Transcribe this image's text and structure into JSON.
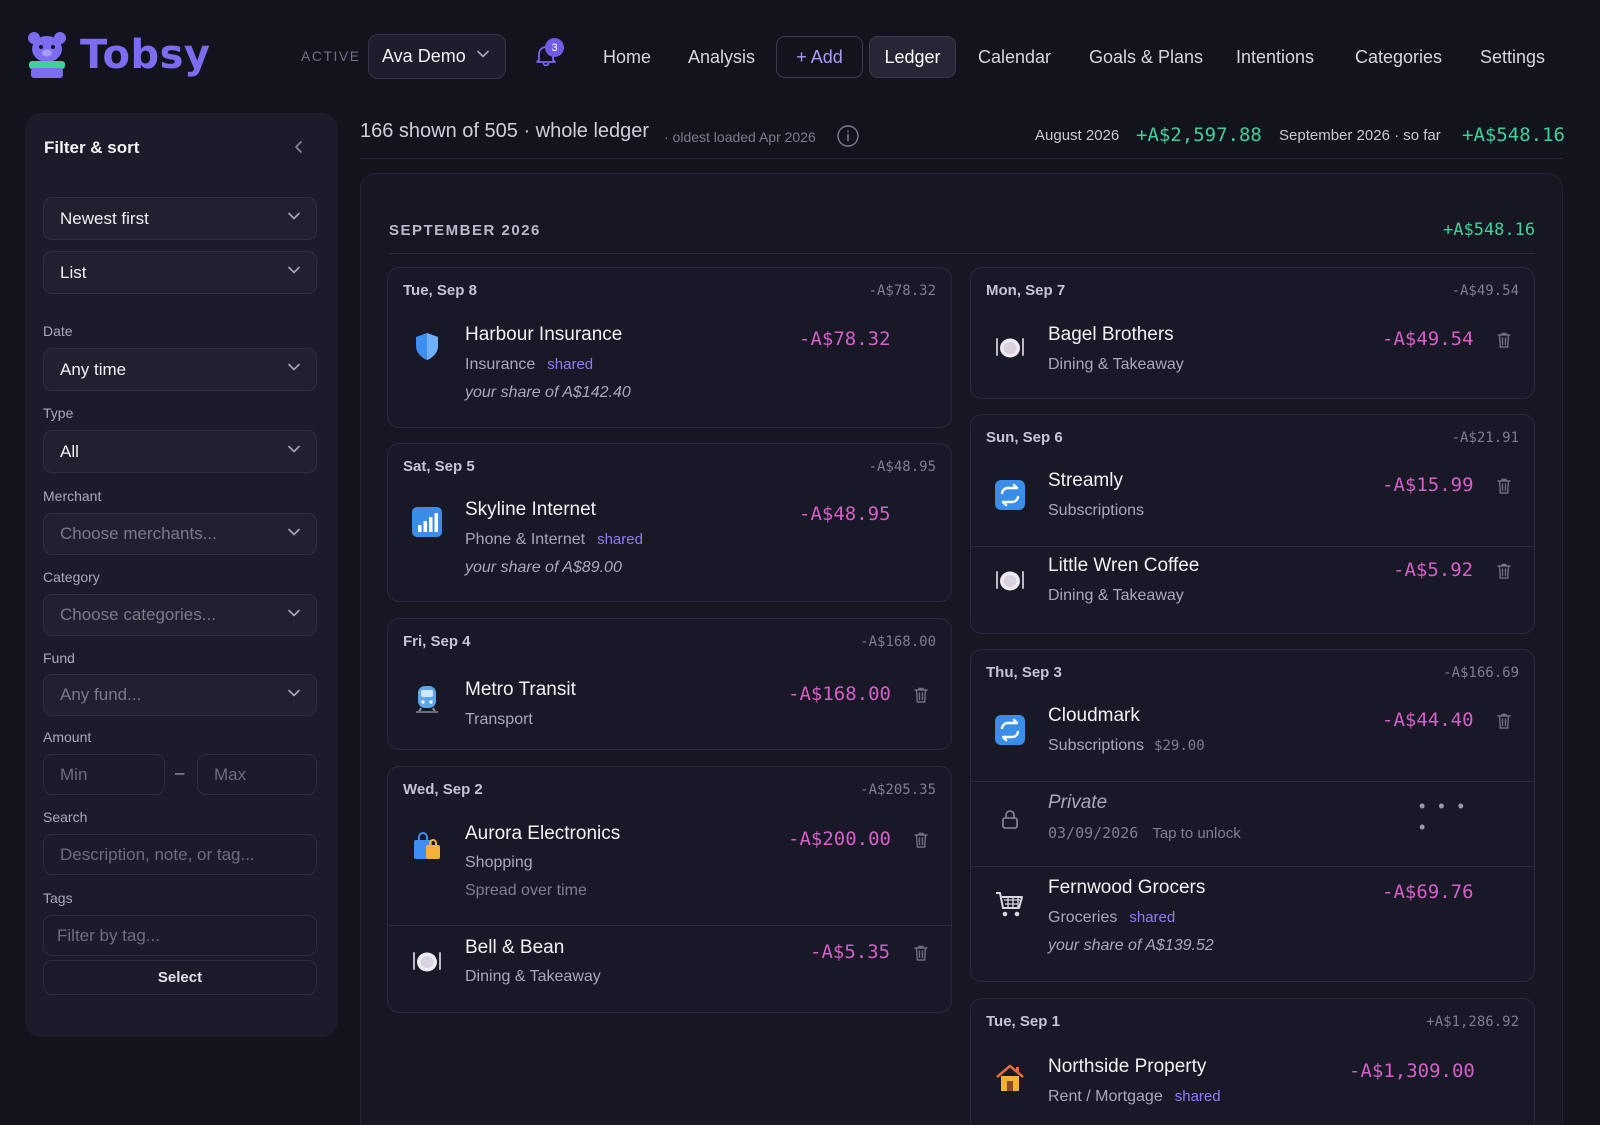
{
  "app": {
    "name": "Tobsy"
  },
  "header": {
    "active_label": "ACTIVE",
    "profile": "Ava Demo",
    "notifications": "3",
    "nav": {
      "home": "Home",
      "analysis": "Analysis",
      "add": "+ Add",
      "ledger": "Ledger",
      "calendar": "Calendar",
      "goals": "Goals & Plans",
      "intentions": "Intentions",
      "categories": "Categories",
      "settings": "Settings"
    }
  },
  "sidebar": {
    "title": "Filter & sort",
    "sort": "Newest first",
    "view": "List",
    "date_label": "Date",
    "date": "Any time",
    "type_label": "Type",
    "type": "All",
    "merchant_label": "Merchant",
    "merchant_placeholder": "Choose merchants...",
    "category_label": "Category",
    "category_placeholder": "Choose categories...",
    "fund_label": "Fund",
    "fund_placeholder": "Any fund...",
    "amount_label": "Amount",
    "min_placeholder": "Min",
    "amount_sep": "–",
    "max_placeholder": "Max",
    "search_label": "Search",
    "search_placeholder": "Description, note, or tag...",
    "tags_label": "Tags",
    "tags_placeholder": "Filter by tag...",
    "select_button": "Select"
  },
  "summary": {
    "shown": "166 shown of 505 · whole ledger",
    "oldest": "· oldest loaded Apr 2026",
    "august_label": "August 2026",
    "august_amount": "+A$2,597.88",
    "september_label": "September 2026 · so far",
    "september_amount": "+A$548.16"
  },
  "section": {
    "title": "SEPTEMBER 2026",
    "total": "+A$548.16"
  },
  "left_days": [
    {
      "day": "Tue, Sep 8",
      "total": "-A$78.32",
      "tx": [
        {
          "name": "Harbour Insurance",
          "category": "Insurance",
          "shared": "shared",
          "share": "your share of A$142.40",
          "amount": "-A$78.32",
          "icon": "shield-icon"
        }
      ]
    },
    {
      "day": "Sat, Sep 5",
      "total": "-A$48.95",
      "tx": [
        {
          "name": "Skyline Internet",
          "category": "Phone & Internet",
          "shared": "shared",
          "share": "your share of A$89.00",
          "amount": "-A$48.95",
          "icon": "signal-icon"
        }
      ]
    },
    {
      "day": "Fri, Sep 4",
      "total": "-A$168.00",
      "tx": [
        {
          "name": "Metro Transit",
          "category": "Transport",
          "amount": "-A$168.00",
          "icon": "metro-icon"
        }
      ]
    },
    {
      "day": "Wed, Sep 2",
      "total": "-A$205.35",
      "tx": [
        {
          "name": "Aurora Electronics",
          "category": "Shopping",
          "note": "Spread over time",
          "amount": "-A$200.00",
          "icon": "shopping-bags-icon"
        },
        {
          "name": "Bell & Bean",
          "category": "Dining & Takeaway",
          "amount": "-A$5.35",
          "icon": "plate-icon"
        }
      ]
    }
  ],
  "right_days": [
    {
      "day": "Mon, Sep 7",
      "total": "-A$49.54",
      "tx": [
        {
          "name": "Bagel Brothers",
          "category": "Dining & Takeaway",
          "amount": "-A$49.54",
          "icon": "plate-icon"
        }
      ]
    },
    {
      "day": "Sun, Sep 6",
      "total": "-A$21.91",
      "tx": [
        {
          "name": "Streamly",
          "category": "Subscriptions",
          "amount": "-A$15.99",
          "icon": "repeat-icon"
        },
        {
          "name": "Little Wren Coffee",
          "category": "Dining & Takeaway",
          "amount": "-A$5.92",
          "icon": "plate-icon"
        }
      ]
    },
    {
      "day": "Thu, Sep 3",
      "total": "-A$166.69",
      "tx": [
        {
          "name": "Cloudmark",
          "category": "Subscriptions",
          "original": "$29.00",
          "amount": "-A$44.40",
          "icon": "repeat-icon"
        },
        {
          "name": "Private",
          "category": "03/09/2026",
          "unlock": "Tap to unlock",
          "amount": "• • • •",
          "icon": "lock-icon"
        },
        {
          "name": "Fernwood Grocers",
          "category": "Groceries",
          "shared": "shared",
          "share": "your share of A$139.52",
          "amount": "-A$69.76",
          "icon": "cart-icon"
        }
      ]
    },
    {
      "day": "Tue, Sep 1",
      "total": "+A$1,286.92",
      "tx": [
        {
          "name": "Northside Property",
          "category": "Rent / Mortgage",
          "shared": "shared",
          "amount": "-A$1,309.00",
          "icon": "house-icon"
        }
      ]
    }
  ],
  "colors": {
    "accent": "#7c6cf0",
    "positive": "#3ed29a",
    "negative": "#d55fc9",
    "shared": "#8c7ef5",
    "background": "#13131e"
  }
}
